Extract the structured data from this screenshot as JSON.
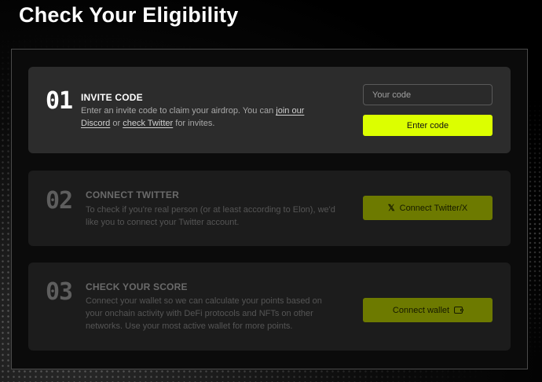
{
  "page": {
    "title": "Check Your Eligibility"
  },
  "colors": {
    "accent": "#dcff00",
    "accent_dim": "#6d7a00",
    "panel_bg": "#0b0b0b",
    "card_active": "#2c2c2c",
    "card_inactive": "#1c1c1c"
  },
  "steps": [
    {
      "number": "01",
      "title": "INVITE CODE",
      "desc_before": "Enter an invite code to claim your airdrop. You can ",
      "link1": "join our Discord",
      "desc_mid": " or ",
      "link2": "check Twitter",
      "desc_after": " for invites.",
      "input_placeholder": "Your code",
      "input_value": "",
      "button_label": "Enter code"
    },
    {
      "number": "02",
      "title": "CONNECT TWITTER",
      "description": "To check if you're real person (or at least according to Elon), we'd like you to connect your Twitter account.",
      "button_icon": "x-logo-icon",
      "button_glyph": "𝕏",
      "button_label": "Connect Twitter/X"
    },
    {
      "number": "03",
      "title": "CHECK YOUR SCORE",
      "description": "Connect your wallet so we can calculate your points based on your onchain activity with DeFi protocols and NFTs on other networks. Use your most active wallet for more points.",
      "button_icon": "wallet-icon",
      "button_label": "Connect wallet"
    }
  ]
}
